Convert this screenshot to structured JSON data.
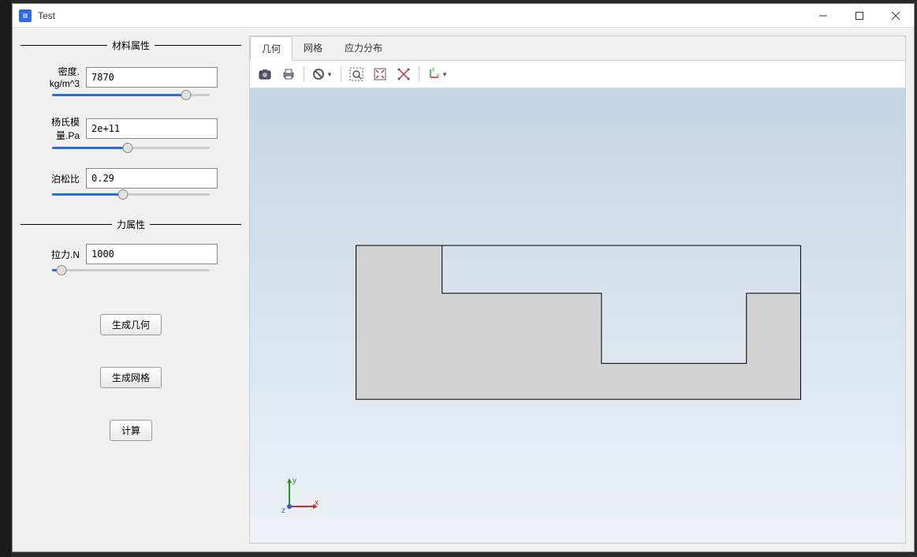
{
  "window": {
    "title": "Test"
  },
  "sidebar": {
    "group1_title": "材料属性",
    "density_label": "密度. kg/m^3",
    "density_value": "7870",
    "youngs_label": "杨氏模量.Pa",
    "youngs_value": "2e+11",
    "poisson_label": "泊松比",
    "poisson_value": "0.29",
    "group2_title": "力属性",
    "force_label": "拉力.N",
    "force_value": "1000",
    "btn_geom": "生成几何",
    "btn_mesh": "生成网格",
    "btn_calc": "计算"
  },
  "tabs": {
    "geom": "几何",
    "mesh": "网格",
    "stress": "应力分布"
  },
  "axes": {
    "x": "x",
    "y": "y",
    "z": "z"
  },
  "toolbar_icons": {
    "camera": "camera-icon",
    "print": "print-icon",
    "cancel": "cancel-icon",
    "zoom_rect": "zoom-rect-icon",
    "fit": "fit-icon",
    "pick": "pick-icon",
    "axis": "axis-icon"
  }
}
